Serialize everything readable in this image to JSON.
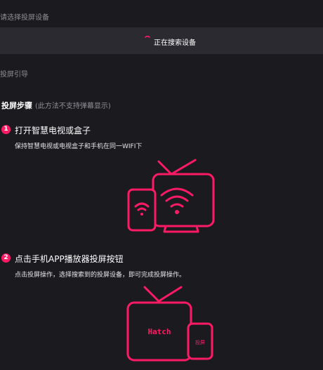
{
  "header": {
    "select_device_label": "请选择投屏设备"
  },
  "search": {
    "status_text": "正在搜索设备",
    "spinner_icon": "loading-spinner-icon"
  },
  "guide": {
    "label": "投屏引导"
  },
  "steps_section": {
    "title": "投屏步骤",
    "note": "(此方法不支持弹幕显示)"
  },
  "steps": [
    {
      "number": "1",
      "title": "打开智慧电视或盒子",
      "desc": "保持智慧电视或电视盒子和手机在同一WIFI下",
      "illustration_icon": "tv-and-phone-wifi-icon"
    },
    {
      "number": "2",
      "title": "点击手机APP播放器投屏按钮",
      "desc": "点击投屏操作，选择搜索到的投屏设备，即可完成投屏操作。",
      "illustration_icon": "tv-watch-phone-cast-icon",
      "tv_text": "Hatch",
      "phone_text": "投屏"
    }
  ],
  "colors": {
    "accent": "#ff1a66",
    "background": "#1b1b1f",
    "bar": "#2a2a30",
    "muted": "#8e8e96"
  }
}
